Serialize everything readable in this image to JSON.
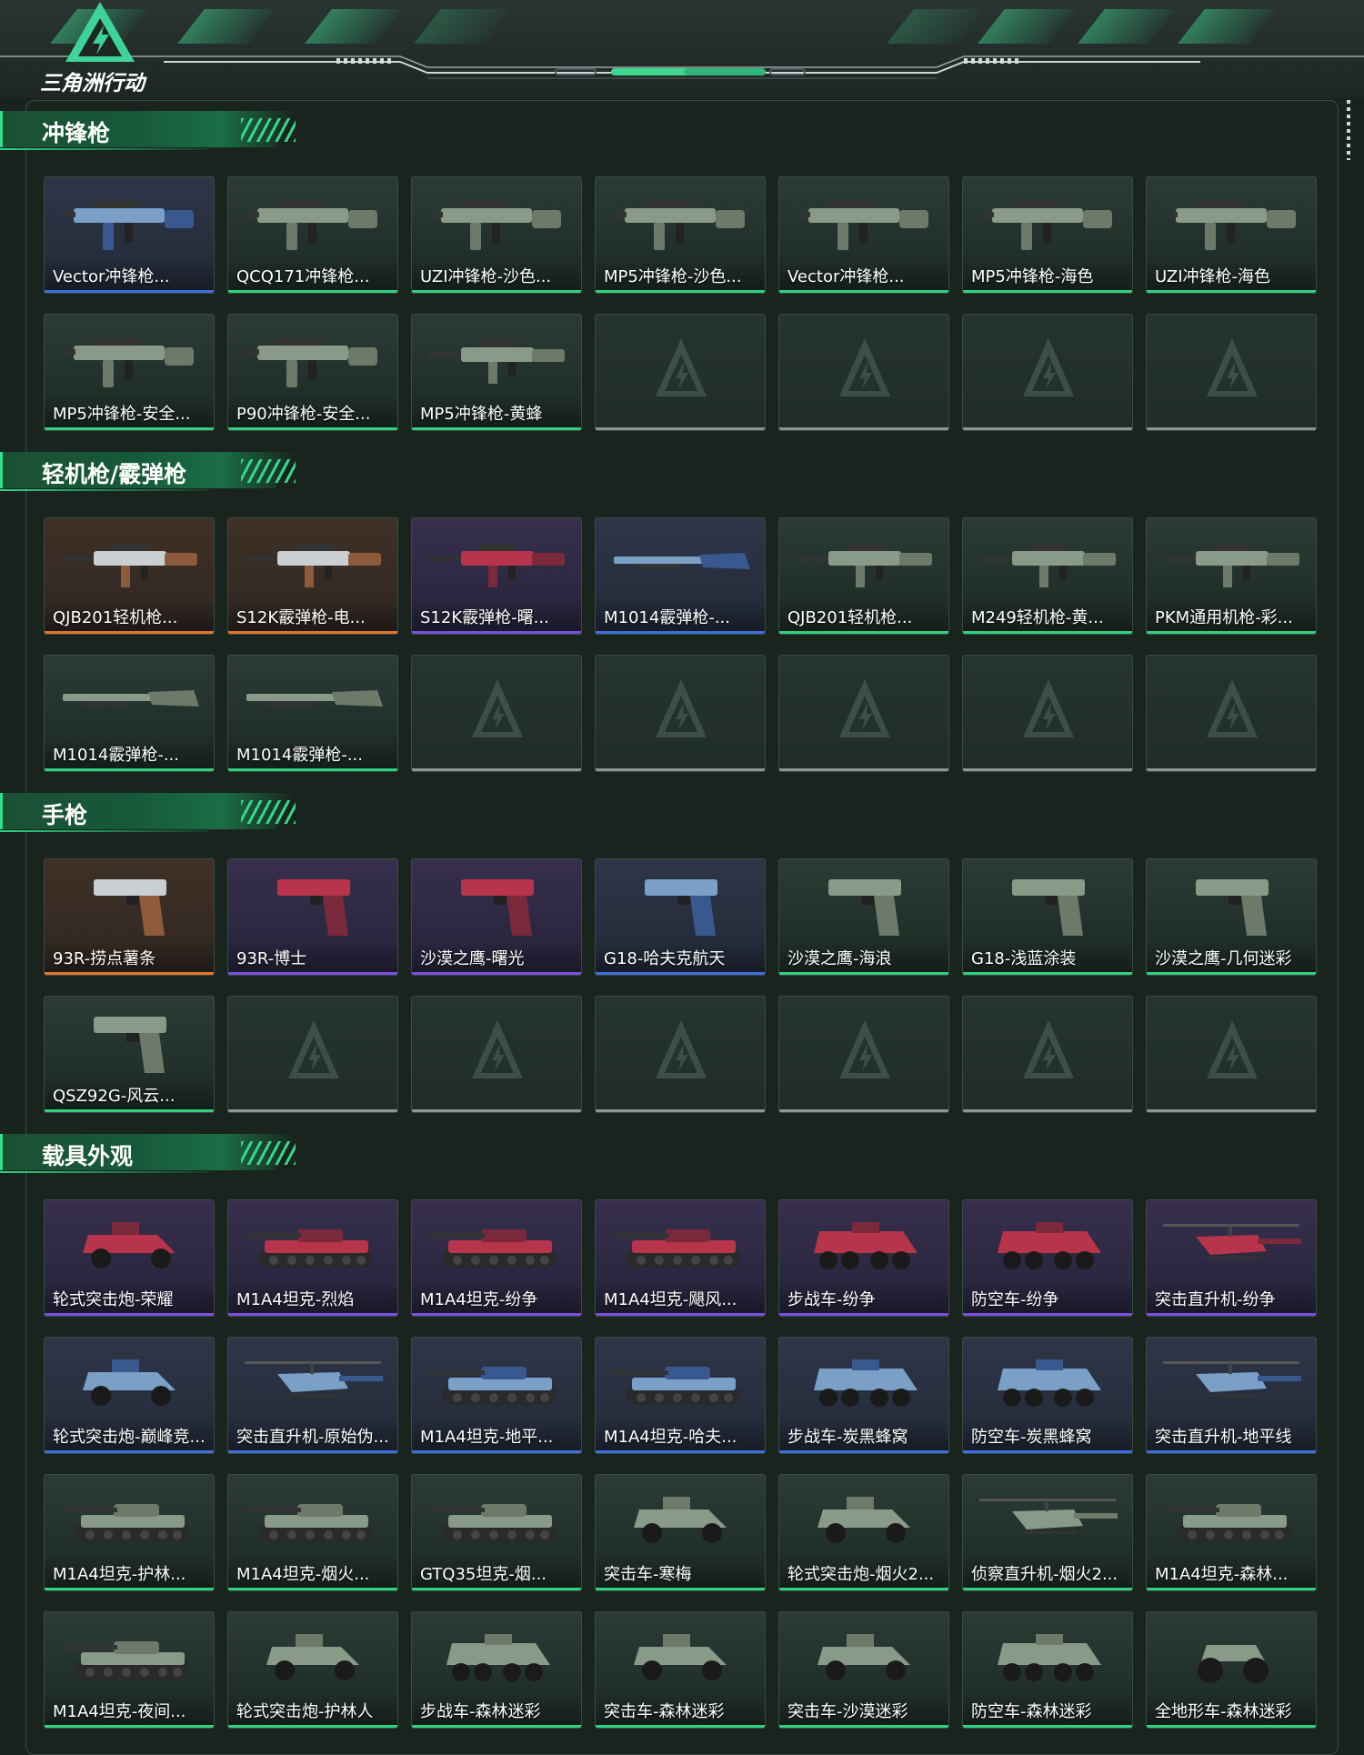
{
  "brand": {
    "logo_text": "三角洲行动"
  },
  "colors": {
    "accent": "#2ed27f",
    "rarity_green": "#2ed27f",
    "rarity_purple": "#7b4ee0",
    "rarity_orange": "#e2752d",
    "rarity_blue": "#3d6fe0",
    "empty": "#8f9692"
  },
  "sections": [
    {
      "title": "冲锋枪",
      "items": [
        {
          "label": "Vector冲锋枪...",
          "rarity": "blue",
          "kind": "smg"
        },
        {
          "label": "QCQ171冲锋枪...",
          "rarity": "green",
          "kind": "smg"
        },
        {
          "label": "UZI冲锋枪-沙色...",
          "rarity": "green",
          "kind": "smg"
        },
        {
          "label": "MP5冲锋枪-沙色...",
          "rarity": "green",
          "kind": "smg"
        },
        {
          "label": "Vector冲锋枪...",
          "rarity": "green",
          "kind": "smg"
        },
        {
          "label": "MP5冲锋枪-海色",
          "rarity": "green",
          "kind": "smg"
        },
        {
          "label": "UZI冲锋枪-海色",
          "rarity": "green",
          "kind": "smg"
        },
        {
          "label": "MP5冲锋枪-安全...",
          "rarity": "green",
          "kind": "smg"
        },
        {
          "label": "P90冲锋枪-安全...",
          "rarity": "green",
          "kind": "smg"
        },
        {
          "label": "MP5冲锋枪-黄蜂",
          "rarity": "green",
          "kind": "rifle"
        },
        {
          "label": "",
          "rarity": "empty"
        },
        {
          "label": "",
          "rarity": "empty"
        },
        {
          "label": "",
          "rarity": "empty"
        },
        {
          "label": "",
          "rarity": "empty"
        }
      ]
    },
    {
      "title": "轻机枪/霰弹枪",
      "items": [
        {
          "label": "QJB201轻机枪...",
          "rarity": "orange",
          "kind": "rifle"
        },
        {
          "label": "S12K霰弹枪-电...",
          "rarity": "orange",
          "kind": "rifle"
        },
        {
          "label": "S12K霰弹枪-曙...",
          "rarity": "purple",
          "kind": "rifle"
        },
        {
          "label": "M1014霰弹枪-...",
          "rarity": "blue",
          "kind": "shotgun"
        },
        {
          "label": "QJB201轻机枪...",
          "rarity": "green",
          "kind": "rifle"
        },
        {
          "label": "M249轻机枪-黄...",
          "rarity": "green",
          "kind": "rifle"
        },
        {
          "label": "PKM通用机枪-彩...",
          "rarity": "green",
          "kind": "rifle"
        },
        {
          "label": "M1014霰弹枪-...",
          "rarity": "green",
          "kind": "shotgun"
        },
        {
          "label": "M1014霰弹枪-...",
          "rarity": "green",
          "kind": "shotgun"
        },
        {
          "label": "",
          "rarity": "empty"
        },
        {
          "label": "",
          "rarity": "empty"
        },
        {
          "label": "",
          "rarity": "empty"
        },
        {
          "label": "",
          "rarity": "empty"
        },
        {
          "label": "",
          "rarity": "empty"
        }
      ]
    },
    {
      "title": "手枪",
      "items": [
        {
          "label": "93R-捞点薯条",
          "rarity": "orange",
          "kind": "pistol"
        },
        {
          "label": "93R-博士",
          "rarity": "purple",
          "kind": "pistol"
        },
        {
          "label": "沙漠之鹰-曙光",
          "rarity": "purple",
          "kind": "pistol"
        },
        {
          "label": "G18-哈夫克航天",
          "rarity": "blue",
          "kind": "pistol"
        },
        {
          "label": "沙漠之鹰-海浪",
          "rarity": "green",
          "kind": "pistol"
        },
        {
          "label": "G18-浅蓝涂装",
          "rarity": "green",
          "kind": "pistol"
        },
        {
          "label": "沙漠之鹰-几何迷彩",
          "rarity": "green",
          "kind": "pistol"
        },
        {
          "label": "QSZ92G-风云...",
          "rarity": "green",
          "kind": "pistol"
        },
        {
          "label": "",
          "rarity": "empty"
        },
        {
          "label": "",
          "rarity": "empty"
        },
        {
          "label": "",
          "rarity": "empty"
        },
        {
          "label": "",
          "rarity": "empty"
        },
        {
          "label": "",
          "rarity": "empty"
        },
        {
          "label": "",
          "rarity": "empty"
        }
      ]
    },
    {
      "title": "载具外观",
      "items": [
        {
          "label": "轮式突击炮-荣耀",
          "rarity": "purple",
          "kind": "car"
        },
        {
          "label": "M1A4坦克-烈焰",
          "rarity": "purple",
          "kind": "tank"
        },
        {
          "label": "M1A4坦克-纷争",
          "rarity": "purple",
          "kind": "tank"
        },
        {
          "label": "M1A4坦克-飓风...",
          "rarity": "purple",
          "kind": "tank"
        },
        {
          "label": "步战车-纷争",
          "rarity": "purple",
          "kind": "apc"
        },
        {
          "label": "防空车-纷争",
          "rarity": "purple",
          "kind": "apc"
        },
        {
          "label": "突击直升机-纷争",
          "rarity": "purple",
          "kind": "heli"
        },
        {
          "label": "轮式突击炮-巅峰竞...",
          "rarity": "blue",
          "kind": "car"
        },
        {
          "label": "突击直升机-原始伪...",
          "rarity": "blue",
          "kind": "heli"
        },
        {
          "label": "M1A4坦克-地平...",
          "rarity": "blue",
          "kind": "tank"
        },
        {
          "label": "M1A4坦克-哈夫...",
          "rarity": "blue",
          "kind": "tank"
        },
        {
          "label": "步战车-炭黑蜂窝",
          "rarity": "blue",
          "kind": "apc"
        },
        {
          "label": "防空车-炭黑蜂窝",
          "rarity": "blue",
          "kind": "apc"
        },
        {
          "label": "突击直升机-地平线",
          "rarity": "blue",
          "kind": "heli"
        },
        {
          "label": "M1A4坦克-护林...",
          "rarity": "green",
          "kind": "tank"
        },
        {
          "label": "M1A4坦克-烟火...",
          "rarity": "green",
          "kind": "tank"
        },
        {
          "label": "GTQ35坦克-烟...",
          "rarity": "green",
          "kind": "tank"
        },
        {
          "label": "突击车-寒梅",
          "rarity": "green",
          "kind": "car"
        },
        {
          "label": "轮式突击炮-烟火2...",
          "rarity": "green",
          "kind": "car"
        },
        {
          "label": "侦察直升机-烟火2...",
          "rarity": "green",
          "kind": "heli"
        },
        {
          "label": "M1A4坦克-森林...",
          "rarity": "green",
          "kind": "tank"
        },
        {
          "label": "M1A4坦克-夜间...",
          "rarity": "green",
          "kind": "tank"
        },
        {
          "label": "轮式突击炮-护林人",
          "rarity": "green",
          "kind": "car"
        },
        {
          "label": "步战车-森林迷彩",
          "rarity": "green",
          "kind": "apc"
        },
        {
          "label": "突击车-森林迷彩",
          "rarity": "green",
          "kind": "car"
        },
        {
          "label": "突击车-沙漠迷彩",
          "rarity": "green",
          "kind": "car"
        },
        {
          "label": "防空车-森林迷彩",
          "rarity": "green",
          "kind": "apc"
        },
        {
          "label": "全地形车-森林迷彩",
          "rarity": "green",
          "kind": "atv"
        }
      ]
    }
  ]
}
